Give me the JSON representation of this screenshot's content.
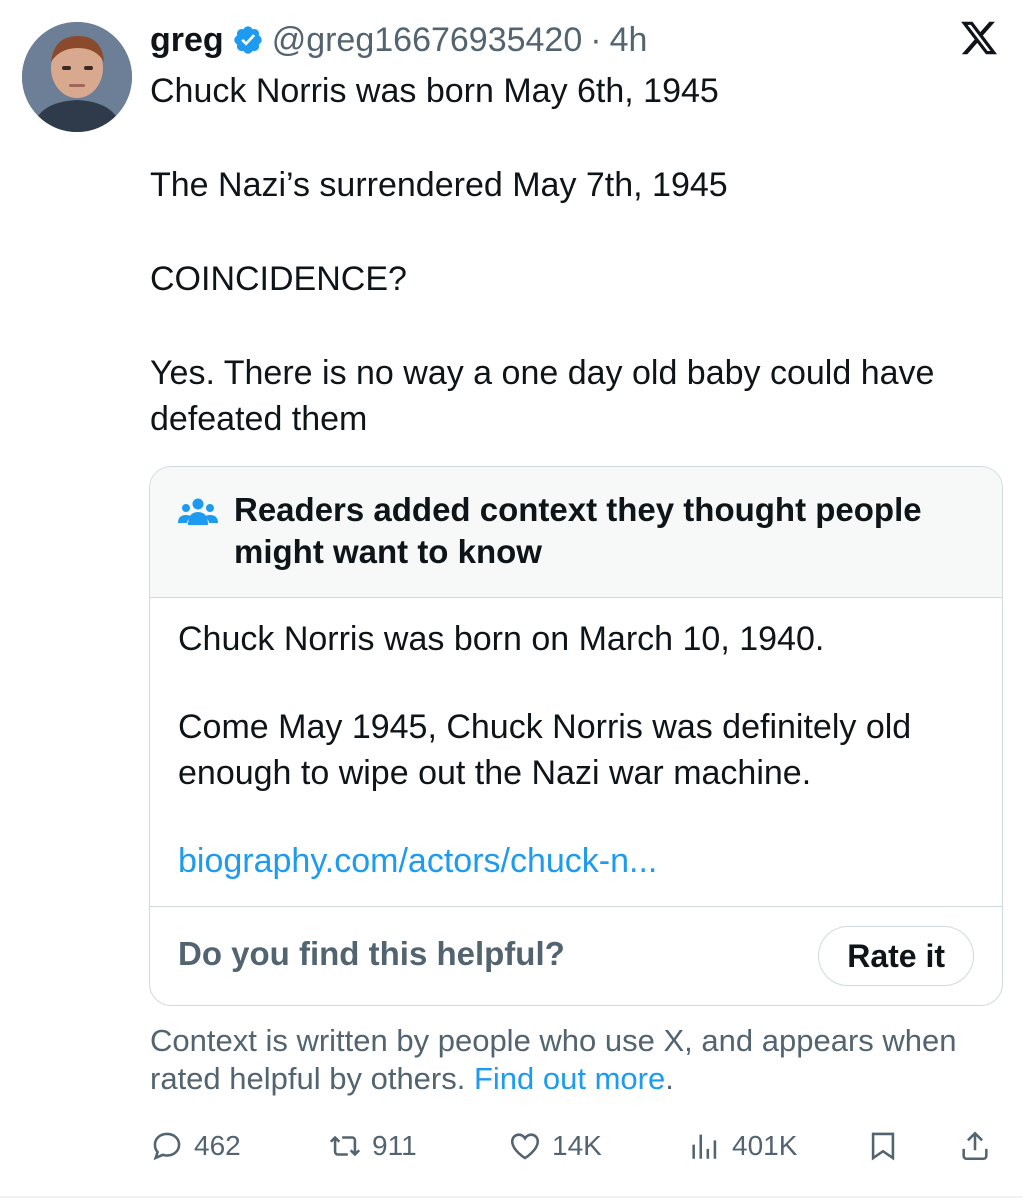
{
  "tweet": {
    "author": {
      "name": "greg",
      "handle": "@greg16676935420",
      "separator": "·",
      "time": "4h",
      "verified": true
    },
    "text": {
      "line1": "Chuck Norris was born May 6th, 1945",
      "line2": "The Nazi’s surrendered May 7th, 1945",
      "line3": "COINCIDENCE?",
      "line4": "Yes. There is no way a one day old baby could have defeated them"
    }
  },
  "note": {
    "title": "Readers added context they thought people might want to know",
    "body1": "Chuck Norris was born on March 10, 1940.",
    "body2": "Come May 1945, Chuck Norris was definitely old enough to wipe out the Nazi war machine.",
    "link": "biography.com/actors/chuck-n...",
    "question": "Do you find this helpful?",
    "rate_label": "Rate it"
  },
  "context": {
    "text": "Context is written by people who use X, and appears when rated helpful by others.",
    "link_label": "Find out more",
    "trail": "."
  },
  "actions": {
    "replies": "462",
    "reposts": "911",
    "likes": "14K",
    "views": "401K"
  },
  "colors": {
    "accent": "#1d9bf0",
    "secondary_text": "#536471",
    "border": "#cfd9de"
  },
  "icons": [
    "avatar",
    "verified-badge-icon",
    "x-logo-icon",
    "people-icon",
    "reply-icon",
    "repost-icon",
    "like-icon",
    "views-icon",
    "bookmark-icon",
    "share-icon"
  ]
}
